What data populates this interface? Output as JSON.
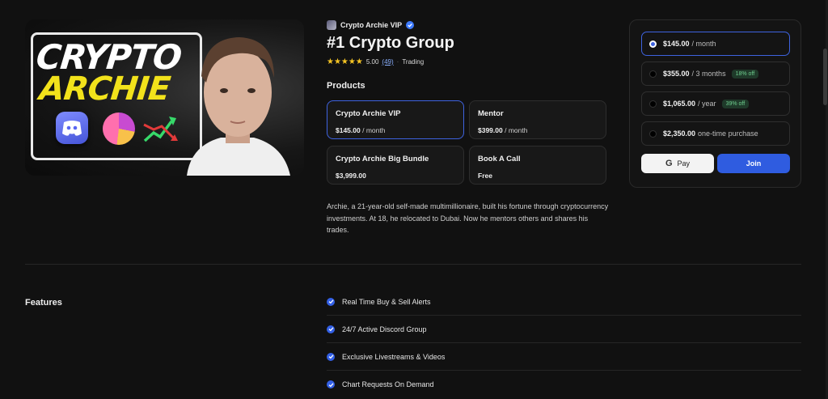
{
  "hero": {
    "line1": "CRYPTO",
    "line2": "ARCHIE"
  },
  "brand": {
    "name": "Crypto Archie VIP",
    "logo_icon": "brand-logo-icon",
    "verified_icon": "verified-check-icon"
  },
  "title": "#1 Crypto Group",
  "rating": {
    "stars": "★★★★★",
    "score": "5.00",
    "count": "(49)",
    "separator": "·",
    "category": "Trading"
  },
  "products": {
    "heading": "Products",
    "items": [
      {
        "name": "Crypto Archie VIP",
        "price": "$145.00",
        "period": " / month",
        "selected": true
      },
      {
        "name": "Mentor",
        "price": "$399.00",
        "period": " / month",
        "selected": false
      },
      {
        "name": "Crypto Archie Big Bundle",
        "price": "$3,999.00",
        "period": "",
        "selected": false
      },
      {
        "name": "Book A Call",
        "price": "Free",
        "period": "",
        "selected": false
      }
    ]
  },
  "description": "Archie, a 21-year-old self-made multimillionaire, built his fortune through cryptocurrency investments. At 18, he relocated to Dubai. Now he mentors others and shares his trades.",
  "pricing": {
    "options": [
      {
        "amount": "$145.00",
        "period": "/ month",
        "badge": ""
      },
      {
        "amount": "$355.00",
        "period": "/ 3 months",
        "badge": "18% off"
      },
      {
        "amount": "$1,065.00",
        "period": "/ year",
        "badge": "39% off"
      },
      {
        "amount": "$2,350.00",
        "period": "one-time purchase",
        "badge": ""
      }
    ],
    "selected_index": 0,
    "gpay_label": "Pay",
    "gpay_letter": "G",
    "join_label": "Join",
    "accent": "#2f5ce0"
  },
  "features": {
    "heading": "Features",
    "items": [
      "Real Time Buy & Sell Alerts",
      "24/7 Active Discord Group",
      "Exclusive Livestreams & Videos",
      "Chart Requests On Demand"
    ]
  }
}
